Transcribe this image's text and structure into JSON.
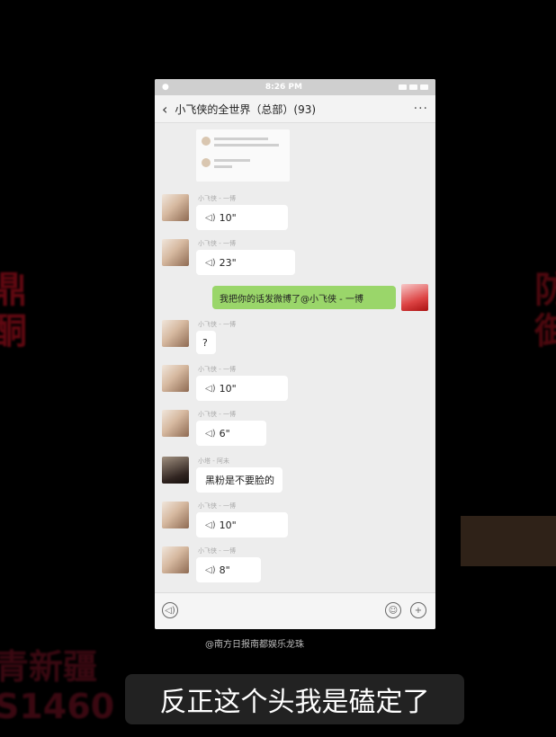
{
  "status_bar": {
    "time": "8:26 PM"
  },
  "chat": {
    "title": "小飞侠的全世界（总部）(93)",
    "messages": [
      {
        "sender": "小飞侠 - 一博",
        "type": "voice",
        "text": "10\""
      },
      {
        "sender": "小飞侠 - 一博",
        "type": "voice",
        "text": "23\""
      },
      {
        "sender": "",
        "type": "text",
        "text": "我把你的话发微博了@小飞侠 - 一博",
        "outgoing": true
      },
      {
        "sender": "小飞侠 - 一博",
        "type": "text",
        "text": "?"
      },
      {
        "sender": "小飞侠 - 一博",
        "type": "voice",
        "text": "10\""
      },
      {
        "sender": "小飞侠 - 一博",
        "type": "voice",
        "text": "6\""
      },
      {
        "sender": "小塔 - 阿未",
        "type": "text",
        "text": "黑粉是不要脸的"
      },
      {
        "sender": "小飞侠 - 一博",
        "type": "voice",
        "text": "10\""
      },
      {
        "sender": "小飞侠 - 一博",
        "type": "voice",
        "text": "8\""
      }
    ]
  },
  "watermark": "@南方日报南都娱乐龙珠",
  "subtitle": "反正这个头我是磕定了",
  "icons": {
    "back": "‹",
    "menu": "···",
    "voice": "◁)",
    "emoji": "☺",
    "add": "+"
  }
}
